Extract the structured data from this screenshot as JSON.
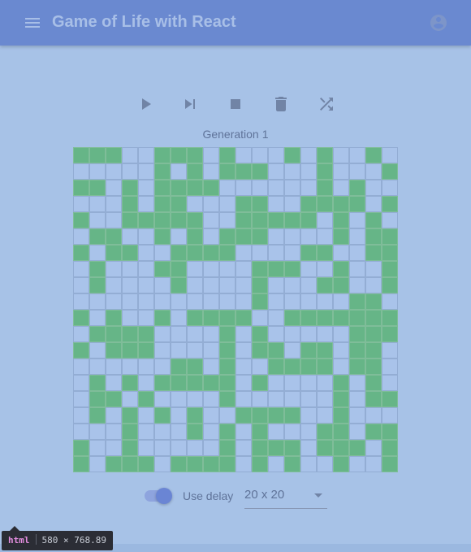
{
  "app": {
    "title": "Game of Life with React",
    "icons": {
      "menu": "menu-icon",
      "account": "account-circle-icon"
    }
  },
  "controls": {
    "items": [
      {
        "name": "play-button",
        "icon": "play-icon"
      },
      {
        "name": "step-button",
        "icon": "skip-next-icon"
      },
      {
        "name": "stop-button",
        "icon": "stop-icon"
      },
      {
        "name": "clear-button",
        "icon": "trash-icon"
      },
      {
        "name": "randomize-button",
        "icon": "shuffle-icon"
      }
    ]
  },
  "generation": {
    "label": "Generation",
    "value": "1"
  },
  "board": {
    "rows": 20,
    "cols": 20,
    "colors": {
      "alive": "#66b587",
      "dead": "#a9c3ea",
      "border": "#93add4"
    },
    "cells": [
      "11100111010001010010",
      "00000101011100010001",
      "11010111100000010100",
      "00010110001100111101",
      "10011111001111101010",
      "01100101011100001011",
      "10110011110000110011",
      "01000110000111001001",
      "01000010000100011001",
      "00000000000100000110",
      "10100101111001111111",
      "01111000010100000111",
      "10111000010110110110",
      "00000011010011110110",
      "01010111110100001010",
      "01101000010000001011",
      "01010101001111001000",
      "00010001010100011011",
      "10010000010111011101",
      "10111011110101001001"
    ]
  },
  "options": {
    "delay_label": "Use delay",
    "delay_on": true,
    "size_value": "20 x 20",
    "size_dropdown_icon": "arrow-drop-down-icon"
  },
  "devtools": {
    "tag": "html",
    "size": "580 × 768.89"
  }
}
